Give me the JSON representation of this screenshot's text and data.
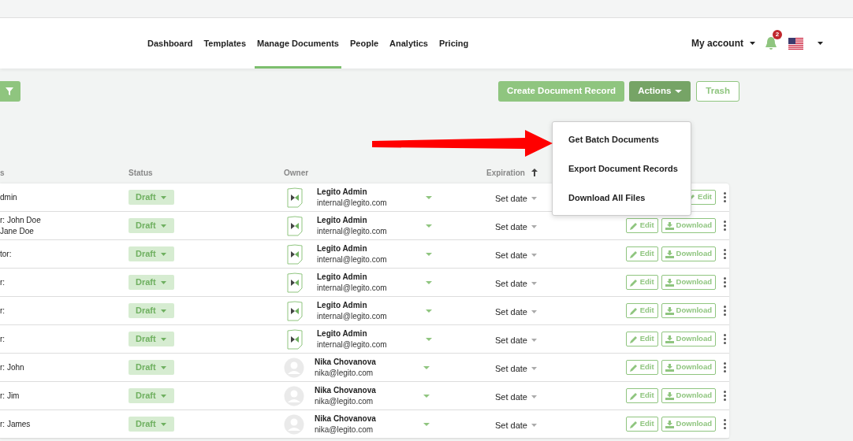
{
  "nav": {
    "links": [
      {
        "label": "Dashboard",
        "selected": false
      },
      {
        "label": "Templates",
        "selected": false
      },
      {
        "label": "Manage Documents",
        "selected": true
      },
      {
        "label": "People",
        "selected": false
      },
      {
        "label": "Analytics",
        "selected": false
      },
      {
        "label": "Pricing",
        "selected": false
      }
    ],
    "account": "My account",
    "notification_count": "2"
  },
  "toolbar": {
    "buttons": [
      {
        "label": "Create Document Record",
        "kind": "primary"
      },
      {
        "label": "Actions",
        "kind": "dropdown"
      },
      {
        "label": "Trash",
        "kind": "outline"
      }
    ]
  },
  "actions_menu": {
    "items": [
      "Get Batch Documents",
      "Export Document Records",
      "Download All Files"
    ]
  },
  "table": {
    "columns": [
      {
        "label": "s",
        "sorted": false
      },
      {
        "label": "Status",
        "sorted": false
      },
      {
        "label": "Owner",
        "sorted": false
      },
      {
        "label": "Expiration",
        "sorted": true
      }
    ],
    "rows": [
      {
        "column_1": [
          "dmin"
        ],
        "status": "Draft",
        "kind": "logo",
        "owner_name": "Legito Admin",
        "owner_email": "internal@legito.com",
        "expiration": "Set date",
        "actions": [
          {
            "kind": "edit",
            "label": "Edit"
          }
        ]
      },
      {
        "column_1": [
          "r: John Doe",
          "Jane Doe"
        ],
        "status": "Draft",
        "kind": "logo",
        "owner_name": "Legito Admin",
        "owner_email": "internal@legito.com",
        "expiration": "Set date",
        "actions": [
          {
            "kind": "edit",
            "label": "Edit"
          },
          {
            "kind": "download",
            "label": "Download"
          }
        ]
      },
      {
        "column_1": [
          "tor:"
        ],
        "status": "Draft",
        "kind": "logo",
        "owner_name": "Legito Admin",
        "owner_email": "internal@legito.com",
        "expiration": "Set date",
        "actions": [
          {
            "kind": "edit",
            "label": "Edit"
          },
          {
            "kind": "download",
            "label": "Download"
          }
        ]
      },
      {
        "column_1": [
          "r:"
        ],
        "status": "Draft",
        "kind": "logo",
        "owner_name": "Legito Admin",
        "owner_email": "internal@legito.com",
        "expiration": "Set date",
        "actions": [
          {
            "kind": "edit",
            "label": "Edit"
          },
          {
            "kind": "download",
            "label": "Download"
          }
        ]
      },
      {
        "column_1": [
          "r:"
        ],
        "status": "Draft",
        "kind": "logo",
        "owner_name": "Legito Admin",
        "owner_email": "internal@legito.com",
        "expiration": "Set date",
        "actions": [
          {
            "kind": "edit",
            "label": "Edit"
          },
          {
            "kind": "download",
            "label": "Download"
          }
        ]
      },
      {
        "column_1": [
          "r:"
        ],
        "status": "Draft",
        "kind": "logo",
        "owner_name": "Legito Admin",
        "owner_email": "internal@legito.com",
        "expiration": "Set date",
        "actions": [
          {
            "kind": "edit",
            "label": "Edit"
          },
          {
            "kind": "download",
            "label": "Download"
          }
        ]
      },
      {
        "column_1": [
          "r: John"
        ],
        "status": "Draft",
        "kind": "person",
        "owner_name": "Nika Chovanova",
        "owner_email": "nika@legito.com",
        "expiration": "Set date",
        "actions": [
          {
            "kind": "edit",
            "label": "Edit"
          },
          {
            "kind": "download",
            "label": "Download"
          }
        ]
      },
      {
        "column_1": [
          "r: Jim"
        ],
        "status": "Draft",
        "kind": "person",
        "owner_name": "Nika Chovanova",
        "owner_email": "nika@legito.com",
        "expiration": "Set date",
        "actions": [
          {
            "kind": "edit",
            "label": "Edit"
          },
          {
            "kind": "download",
            "label": "Download"
          }
        ]
      },
      {
        "column_1": [
          "r: James"
        ],
        "status": "Draft",
        "kind": "person",
        "owner_name": "Nika Chovanova",
        "owner_email": "nika@legito.com",
        "expiration": "Set date",
        "actions": [
          {
            "kind": "edit",
            "label": "Edit"
          },
          {
            "kind": "download",
            "label": "Download"
          }
        ]
      }
    ]
  }
}
